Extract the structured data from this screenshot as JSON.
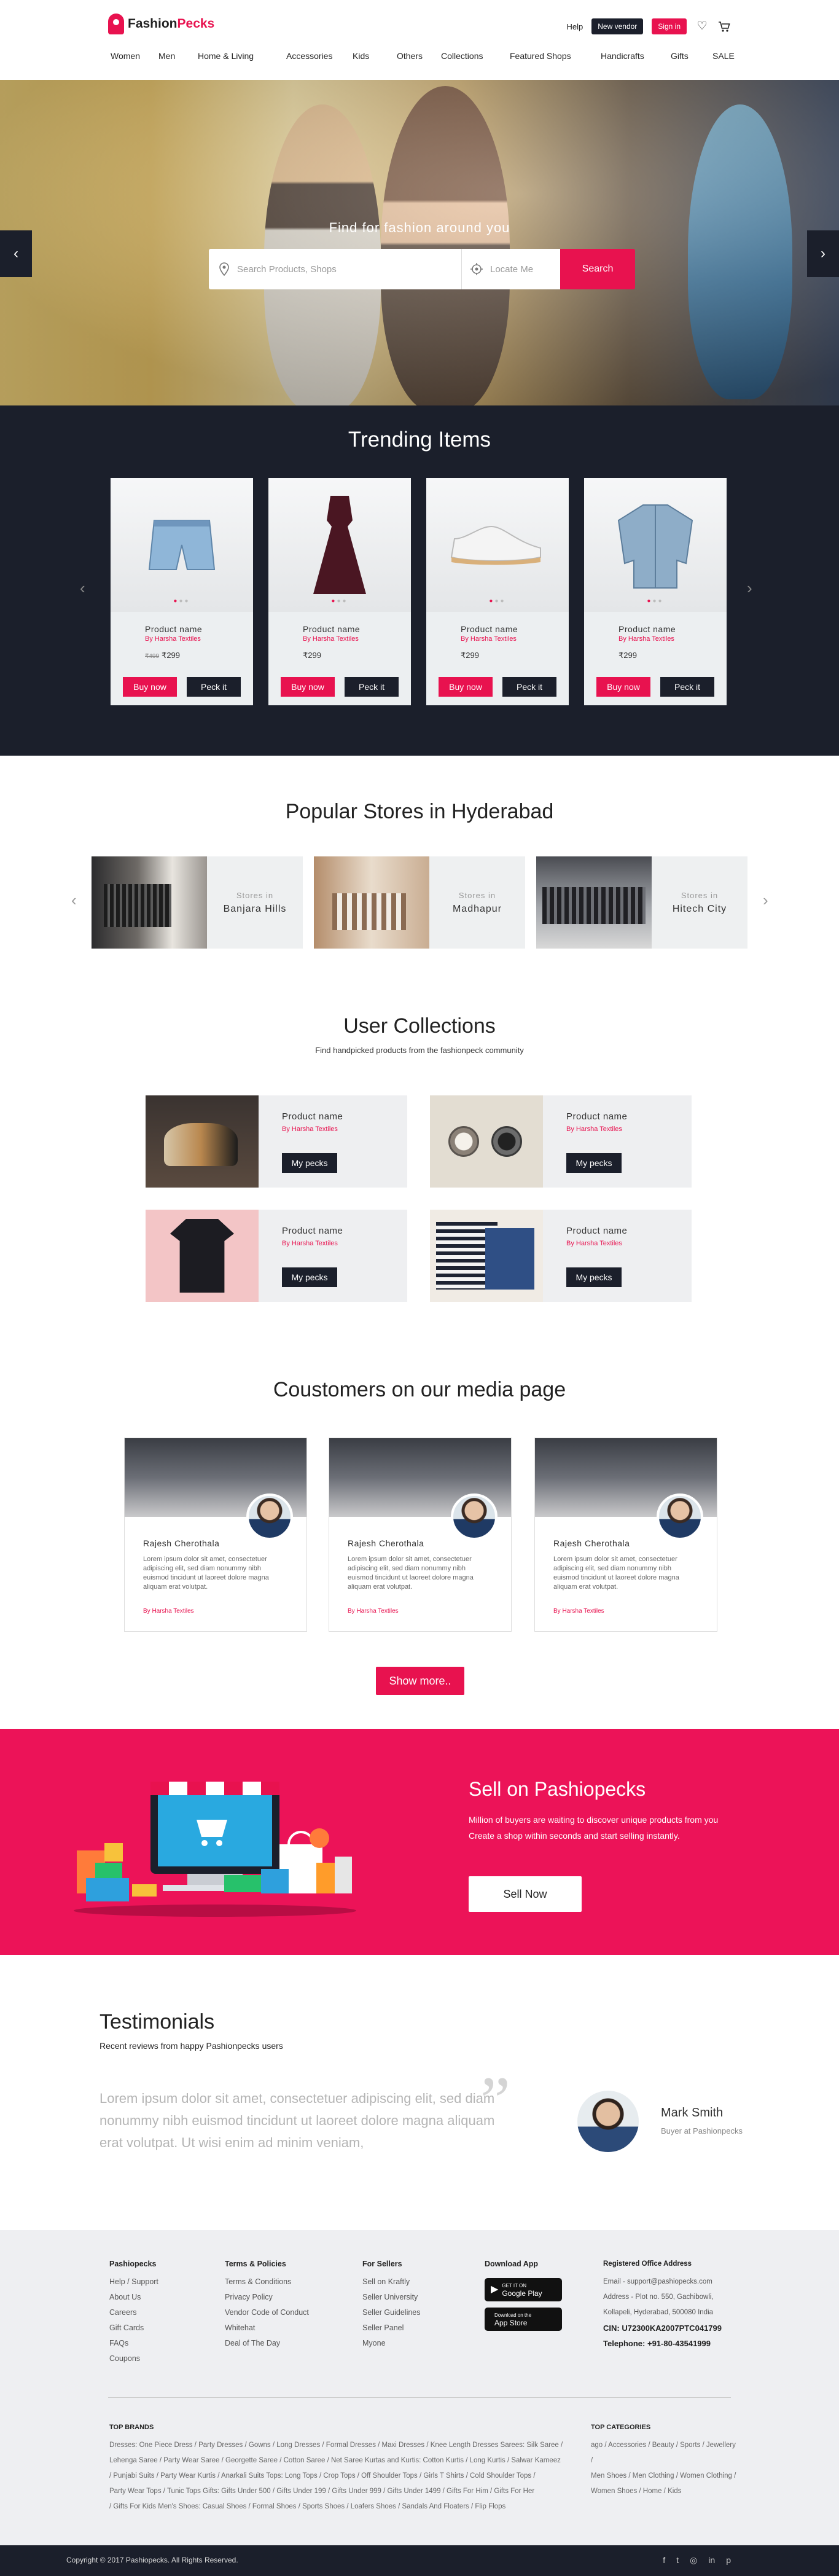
{
  "header": {
    "logo_prefix": "Fashion",
    "logo_suffix": "Pecks",
    "help": "Help",
    "new_vendor": "New vendor",
    "sign_in": "Sign in",
    "nav": [
      "Women",
      "Men",
      "Home & Living",
      "Accessories",
      "Kids",
      "Others",
      "Collections",
      "Featured Shops",
      "Handicrafts",
      "Gifts",
      "SALE"
    ]
  },
  "hero": {
    "title": "Find for fashion around you",
    "search_placeholder": "Search Products, Shops",
    "locate_placeholder": "Locate Me",
    "search_button": "Search"
  },
  "trending": {
    "title": "Trending Items",
    "items": [
      {
        "name": "Product name",
        "by": "By Harsha Textiles",
        "old_price": "₹499",
        "price": "₹299",
        "buy": "Buy now",
        "peck": "Peck it"
      },
      {
        "name": "Product name",
        "by": "By Harsha Textiles",
        "price": "₹299",
        "buy": "Buy now",
        "peck": "Peck it"
      },
      {
        "name": "Product name",
        "by": "By Harsha Textiles",
        "price": "₹299",
        "buy": "Buy now",
        "peck": "Peck it"
      },
      {
        "name": "Product name",
        "by": "By Harsha Textiles",
        "price": "₹299",
        "buy": "Buy now",
        "peck": "Peck it"
      }
    ]
  },
  "stores": {
    "title": "Popular Stores in Hyderabad",
    "items": [
      {
        "label": "Stores in",
        "place": "Banjara Hills"
      },
      {
        "label": "Stores in",
        "place": "Madhapur"
      },
      {
        "label": "Stores in",
        "place": "Hitech City"
      }
    ]
  },
  "collections": {
    "title": "User Collections",
    "subtitle": "Find handpicked products from the fashionpeck community",
    "items": [
      {
        "name": "Product name",
        "by": "By Harsha Textiles",
        "button": "My pecks"
      },
      {
        "name": "Product name",
        "by": "By Harsha Textiles",
        "button": "My pecks"
      },
      {
        "name": "Product name",
        "by": "By Harsha Textiles",
        "button": "My pecks"
      },
      {
        "name": "Product name",
        "by": "By Harsha Textiles",
        "button": "My pecks"
      }
    ]
  },
  "media": {
    "title": "Coustomers on our media page",
    "cards": [
      {
        "name": "Rajesh Cherothala",
        "text": "Lorem ipsum dolor sit amet, consectetuer adipiscing elit, sed diam nonummy nibh euismod tincidunt ut laoreet dolore magna aliquam erat volutpat.",
        "by": "By Harsha Textiles"
      },
      {
        "name": "Rajesh Cherothala",
        "text": "Lorem ipsum dolor sit amet, consectetuer adipiscing elit, sed diam nonummy nibh euismod tincidunt ut laoreet dolore magna aliquam erat volutpat.",
        "by": "By Harsha Textiles"
      },
      {
        "name": "Rajesh Cherothala",
        "text": "Lorem ipsum dolor sit amet, consectetuer adipiscing elit, sed diam nonummy nibh euismod tincidunt ut laoreet dolore magna aliquam erat volutpat.",
        "by": "By Harsha Textiles"
      }
    ],
    "show_more": "Show more.."
  },
  "sell": {
    "title": "Sell on Pashiopecks",
    "line1": "Million of buyers are waiting to discover unique products from you",
    "line2": "Create a shop within seconds and start selling instantly.",
    "button": "Sell Now"
  },
  "testimonials": {
    "title": "Testimonials",
    "subtitle": "Recent reviews from happy Pashionpecks users",
    "quote": "Lorem ipsum dolor sit amet, consectetuer adipiscing elit, sed diam nonummy nibh euismod tincidunt ut laoreet dolore magna aliquam erat volutpat. Ut wisi enim ad minim veniam,",
    "name": "Mark Smith",
    "role": "Buyer at Pashionpecks"
  },
  "footer": {
    "col1": {
      "title": "Pashiopecks",
      "links": [
        "Help / Support",
        "About Us",
        "Careers",
        "Gift Cards",
        "FAQs",
        "Coupons"
      ]
    },
    "col2": {
      "title": "Terms & Policies",
      "links": [
        "Terms & Conditions",
        "Privacy Policy",
        "Vendor Code of Conduct",
        "Whitehat",
        "Deal of The Day"
      ]
    },
    "col3": {
      "title": "For Sellers",
      "links": [
        "Sell on Kraftly",
        "Seller University",
        "Seller Guidelines",
        "Seller Panel",
        "Myone"
      ]
    },
    "col4": {
      "title": "Download App",
      "google_small": "GET IT ON",
      "google": "Google Play",
      "apple_small": "Download on the",
      "apple": "App Store"
    },
    "col5": {
      "title": "Registered Office Address",
      "email": "Email - support@pashiopecks.com",
      "address1": "Address - Plot no. 550, Gachibowli,",
      "address2": "Kollapeli, Hyderabad, 500080 India",
      "cin": "CIN: U72300KA2007PTC041799",
      "phone": "Telephone: +91-80-43541999"
    },
    "brands_title": "TOP BRANDS",
    "brands": [
      "Dresses: One Piece Dress / Party Dresses / Gowns / Long Dresses / Formal Dresses / Maxi Dresses / Knee Length Dresses Sarees: Silk Saree /",
      "Lehenga Saree / Party Wear Saree / Georgette Saree / Cotton Saree / Net Saree Kurtas and Kurtis: Cotton Kurtis / Long Kurtis / Salwar Kameez",
      "/ Punjabi Suits / Party Wear Kurtis / Anarkali Suits Tops: Long Tops / Crop Tops / Off Shoulder Tops / Girls T Shirts / Cold Shoulder Tops /",
      "Party Wear Tops / Tunic Tops Gifts: Gifts Under 500 / Gifts Under 199 / Gifts Under 999 / Gifts Under 1499 / Gifts For Him / Gifts For Her",
      "/ Gifts For Kids Men's Shoes: Casual Shoes / Formal Shoes / Sports Shoes / Loafers Shoes / Sandals And Floaters / Flip Flops"
    ],
    "categories_title": "TOP CATEGORIES",
    "categories": [
      "ago / Accessories / Beauty / Sports / Jewellery /",
      "Men Shoes / Men Clothing / Women Clothing /",
      "Women Shoes / Home / Kids"
    ],
    "copyright": "Copyright © 2017 Pashiopecks. All Rights Reserved."
  },
  "colors": {
    "accent": "#e8124f",
    "dark": "#1b1f2b",
    "sell_bg": "#ec1358"
  }
}
